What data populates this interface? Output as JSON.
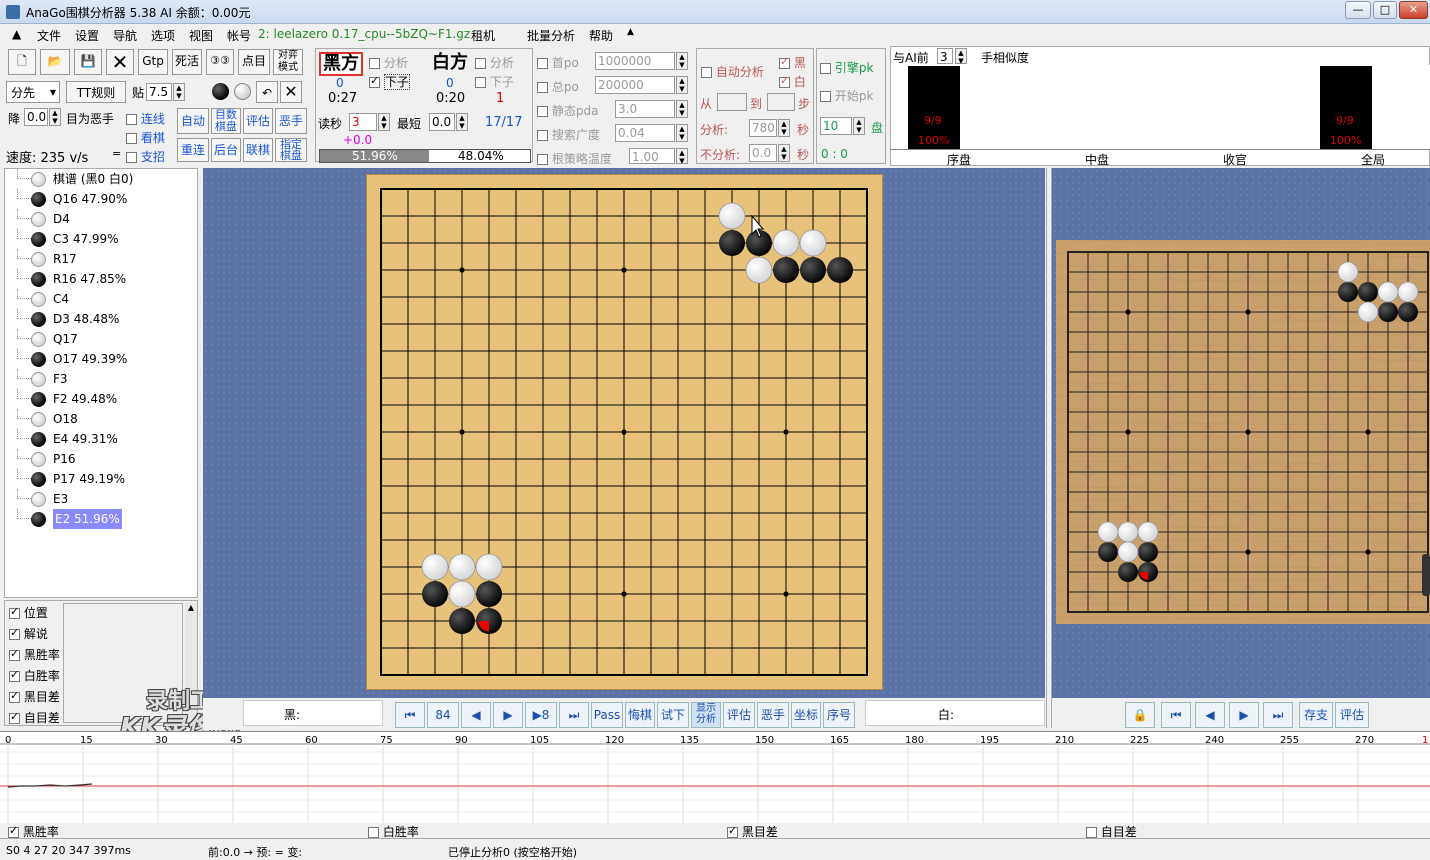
{
  "window": {
    "title": "AnaGo围棋分析器 5.38  AI  余额：0.00元"
  },
  "menu": {
    "items": [
      "文件",
      "设置",
      "导航",
      "选项",
      "视图",
      "帐号"
    ],
    "file_name": "2: leelazero 0.17_cpu--5bZQ~F1.gz",
    "items2": [
      "租机",
      "批量分析",
      "帮助"
    ]
  },
  "toolbar": {
    "gtp": "Gtp",
    "life_death": "死活",
    "count": "点目",
    "battle_mode": "对弈模式",
    "handicap": "分先",
    "tt_rule": "TT规则",
    "komi_label": "贴",
    "komi": "7.5",
    "drop_label": "降",
    "drop": "0.0",
    "evil_label": "目为恶手",
    "speed": "速度: 235 v/s",
    "link_label": "连线",
    "view_label": "看棋",
    "branch_label": "支招",
    "auto": "自动",
    "count_board": "目数棋盘",
    "evaluate": "评估",
    "bad_move": "恶手",
    "redo": "重连",
    "backend": "后台",
    "joint": "联棋",
    "pointed": "指定棋盘",
    "black_side": "黑方",
    "black_count": "0",
    "black_time": "0:27",
    "white_side": "白方",
    "white_count": "0",
    "white_time": "0:20",
    "white_num": "1",
    "analysis": "分析",
    "place": "下子",
    "read_sec_label": "读秒",
    "read_sec": "3",
    "min_label": "最短",
    "min": "0.0",
    "moves": "17/17",
    "delta": "+0.0",
    "black_pct": "51.96%",
    "white_pct": "48.04%",
    "first_po": "首po",
    "first_po_val": "1000000",
    "total_po": "总po",
    "total_po_val": "200000",
    "static_pda": "静态pda",
    "static_pda_val": "3.0",
    "search_width": "搜索广度",
    "search_width_val": "0.04",
    "root_temp": "根策略温度",
    "root_temp_val": "1.00",
    "auto_analysis": "自动分析",
    "black": "黑",
    "white": "白",
    "from": "从",
    "to": "到",
    "step": "步",
    "analyze": "分析:",
    "analyze_val": "780",
    "sec": "秒",
    "no_analyze": "不分析:",
    "no_analyze_val": "0.0",
    "engine_pk": "引擎pk",
    "start_pk": "开始pk",
    "games": "10",
    "games_unit": "盘",
    "score": "0 : 0"
  },
  "ai_panel": {
    "label": "与AI前",
    "num": "3",
    "similarity": "手相似度",
    "opening_val": "9/9",
    "opening_pct": "100%",
    "total_val": "9/9",
    "total_pct": "100%",
    "phases": [
      "序盘",
      "中盘",
      "收官",
      "全局"
    ]
  },
  "moves": [
    {
      "text": "棋谱 (黑0 白0)",
      "color": "w"
    },
    {
      "text": "Q16 47.90%",
      "color": "b"
    },
    {
      "text": "D4",
      "color": "w"
    },
    {
      "text": "C3   47.99%",
      "color": "b"
    },
    {
      "text": "R17",
      "color": "w"
    },
    {
      "text": "R16 47.85%",
      "color": "b"
    },
    {
      "text": "C4",
      "color": "w"
    },
    {
      "text": "D3   48.48%",
      "color": "b"
    },
    {
      "text": "Q17",
      "color": "w"
    },
    {
      "text": "O17 49.39%",
      "color": "b"
    },
    {
      "text": "F3",
      "color": "w"
    },
    {
      "text": "F2   49.48%",
      "color": "b"
    },
    {
      "text": "O18",
      "color": "w"
    },
    {
      "text": "E4   49.31%",
      "color": "b"
    },
    {
      "text": "P16",
      "color": "w"
    },
    {
      "text": "P17 49.19%",
      "color": "b"
    },
    {
      "text": "E3",
      "color": "w"
    },
    {
      "text": "E2   51.96%",
      "color": "b",
      "selected": true
    }
  ],
  "options": [
    {
      "label": "位置",
      "checked": true
    },
    {
      "label": "解说",
      "checked": true
    },
    {
      "label": "黑胜率",
      "checked": true
    },
    {
      "label": "白胜率",
      "checked": true
    },
    {
      "label": "黑目差",
      "checked": true
    },
    {
      "label": "自目差",
      "checked": true
    }
  ],
  "watermark": {
    "line1": "录制工具",
    "line2": "KK录像机"
  },
  "nav": {
    "black_label": "黑:",
    "white_label": "白:",
    "buttons": [
      "84",
      "Pass",
      "悔棋",
      "试下",
      "显示分析",
      "评估",
      "恶手",
      "坐标",
      "序号"
    ],
    "b8": "8",
    "right_buttons": [
      "存支",
      "评估"
    ]
  },
  "graph": {
    "ticks": [
      "0",
      "15",
      "30",
      "45",
      "60",
      "75",
      "90",
      "105",
      "120",
      "135",
      "150",
      "165",
      "180",
      "195",
      "210",
      "225",
      "240",
      "255",
      "270"
    ],
    "checks": [
      {
        "label": "黑胜率",
        "checked": true
      },
      {
        "label": "白胜率",
        "checked": false
      },
      {
        "label": "黑目差",
        "checked": true
      },
      {
        "label": "自目差",
        "checked": false
      }
    ]
  },
  "status": {
    "s1": "S0  4  27  20    347  397ms",
    "s2": "前:0.0 → 预:  = 变:",
    "s3": "已停止分析0 (按空格开始)"
  },
  "main_board": {
    "black": [
      [
        13,
        2
      ],
      [
        14,
        2
      ],
      [
        15,
        3
      ],
      [
        16,
        3
      ],
      [
        17,
        3
      ],
      [
        2,
        15
      ],
      [
        3,
        16
      ],
      [
        4,
        16
      ],
      [
        4,
        15
      ]
    ],
    "white": [
      [
        13,
        1
      ],
      [
        15,
        2
      ],
      [
        16,
        2
      ],
      [
        14,
        3
      ],
      [
        2,
        14
      ],
      [
        3,
        14
      ],
      [
        3,
        15
      ],
      [
        4,
        14
      ]
    ],
    "last_move": [
      4,
      16
    ]
  },
  "side_board": {
    "black": [
      [
        14,
        2
      ],
      [
        15,
        2
      ],
      [
        16,
        3
      ],
      [
        17,
        3
      ],
      [
        2,
        15
      ],
      [
        3,
        16
      ],
      [
        4,
        16
      ],
      [
        4,
        15
      ]
    ],
    "white": [
      [
        14,
        1
      ],
      [
        16,
        2
      ],
      [
        17,
        2
      ],
      [
        15,
        3
      ],
      [
        2,
        14
      ],
      [
        3,
        14
      ],
      [
        3,
        15
      ],
      [
        4,
        14
      ]
    ],
    "last_move": [
      4,
      16
    ]
  }
}
